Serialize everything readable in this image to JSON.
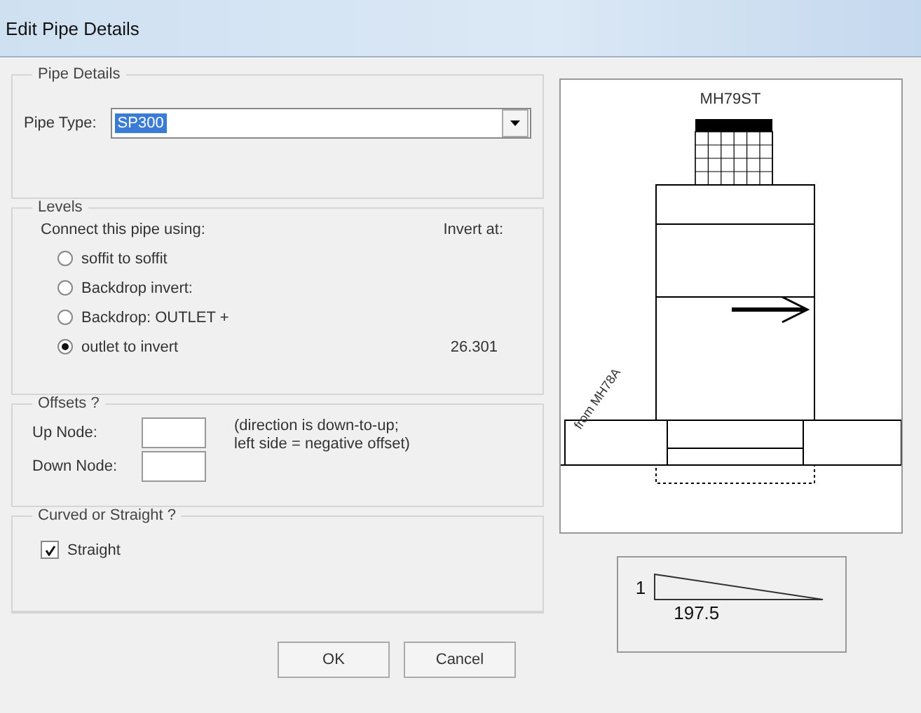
{
  "window": {
    "title": "Edit Pipe Details"
  },
  "pipe_details": {
    "legend": "Pipe Details",
    "label": "Pipe Type:",
    "value": "SP300"
  },
  "levels": {
    "legend": "Levels",
    "prompt": "Connect this pipe using:",
    "invert_label": "Invert at:",
    "options": [
      {
        "label": "soffit to soffit",
        "selected": false
      },
      {
        "label": "Backdrop invert:",
        "selected": false
      },
      {
        "label": "Backdrop:   OUTLET +",
        "selected": false
      },
      {
        "label": "outlet to invert",
        "selected": true,
        "invert": "26.301"
      }
    ]
  },
  "offsets": {
    "legend": "Offsets ?",
    "fields": [
      {
        "label": "Up Node:"
      },
      {
        "label": "Down Node:"
      }
    ],
    "note": "(direction is down-to-up;\nleft side = negative offset)"
  },
  "shape": {
    "legend": "Curved or Straight ?",
    "checkbox": {
      "label": "Straight",
      "checked": true
    }
  },
  "buttons": [
    "OK",
    "Cancel"
  ],
  "diagram": {
    "manhole": "MH79ST",
    "from": "from MH78A"
  },
  "slope": {
    "rise": "1",
    "run": "197.5"
  }
}
